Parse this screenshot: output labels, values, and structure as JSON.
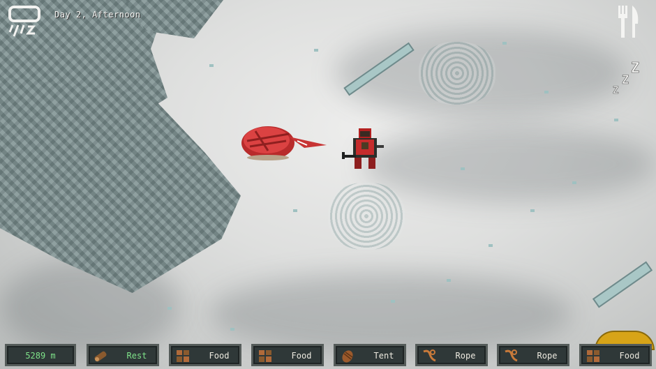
{
  "hud": {
    "time_label": "Day 2, Afternoon",
    "weather_icon": "storm-cloud-icon",
    "hunger_icon": "fork-knife-icon",
    "sleep_icon": "zzz-icon",
    "sleep_text": "ZZZ"
  },
  "inventory": {
    "distance": "5289 m",
    "slots": [
      {
        "label": "Rest",
        "icon": "log-icon"
      },
      {
        "label": "Food",
        "icon": "food-crate-icon"
      },
      {
        "label": "Food",
        "icon": "food-crate-icon"
      },
      {
        "label": "Tent",
        "icon": "tent-bag-icon"
      },
      {
        "label": "Rope",
        "icon": "rope-icon"
      },
      {
        "label": "Rope",
        "icon": "rope-icon"
      },
      {
        "label": "Food",
        "icon": "food-crate-icon"
      }
    ]
  },
  "colors": {
    "snow": "#e6e7e5",
    "rock": "#8a9696",
    "tent": "#d23a3a",
    "accent_green": "#7fe38a",
    "slot_bg": "#2f3838"
  }
}
